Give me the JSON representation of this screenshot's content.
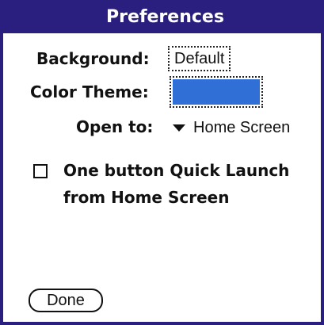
{
  "app": {
    "title": "Preferences"
  },
  "colors": {
    "titlebar": "#2a1f7e",
    "theme_swatch": "#2f6fd6"
  },
  "form": {
    "background_label": "Background:",
    "background_value": "Default",
    "theme_label": "Color Theme:",
    "open_to_label": "Open to:",
    "open_to_value": "Home Screen",
    "quick_launch_line1": "One button Quick Launch",
    "quick_launch_line2": "from Home Screen",
    "quick_launch_checked": false
  },
  "actions": {
    "done_label": "Done"
  }
}
